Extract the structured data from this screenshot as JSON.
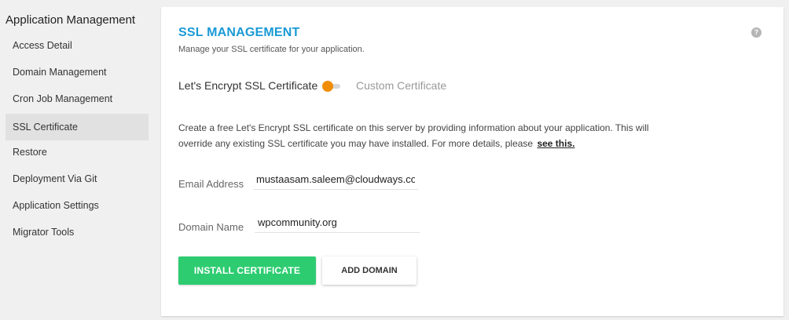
{
  "sidebar": {
    "title": "Application Management",
    "items": [
      {
        "label": "Access Detail",
        "active": false
      },
      {
        "label": "Domain Management",
        "active": false
      },
      {
        "label": "Cron Job Management",
        "active": false
      },
      {
        "label": "SSL Certificate",
        "active": true
      },
      {
        "label": "Restore",
        "active": false
      },
      {
        "label": "Deployment Via Git",
        "active": false
      },
      {
        "label": "Application Settings",
        "active": false
      },
      {
        "label": "Migrator Tools",
        "active": false
      }
    ]
  },
  "panel": {
    "title": "SSL MANAGEMENT",
    "subtitle": "Manage your SSL certificate for your application.",
    "help_icon": "?",
    "toggle": {
      "left_label": "Let's Encrypt SSL Certificate",
      "right_label": "Custom Certificate",
      "selected": "Let's Encrypt SSL Certificate"
    },
    "description": "Create a free Let's Encrypt SSL certificate on this server by providing information about your application. This will override any existing SSL certificate you may have installed. For more details, please",
    "description_link": "see this.",
    "form": {
      "email_label": "Email Address",
      "email_value": "mustaasam.saleem@cloudways.com",
      "domain_label": "Domain Name",
      "domain_value": "wpcommunity.org"
    },
    "buttons": {
      "install": "INSTALL CERTIFICATE",
      "add_domain": "ADD DOMAIN"
    }
  },
  "colors": {
    "accent_blue": "#1a9ad6",
    "toggle_orange": "#f08c00",
    "install_green": "#2ecc71",
    "active_item_bg": "#e1e1e1"
  },
  "icons": {
    "help": "question-circle-icon"
  }
}
